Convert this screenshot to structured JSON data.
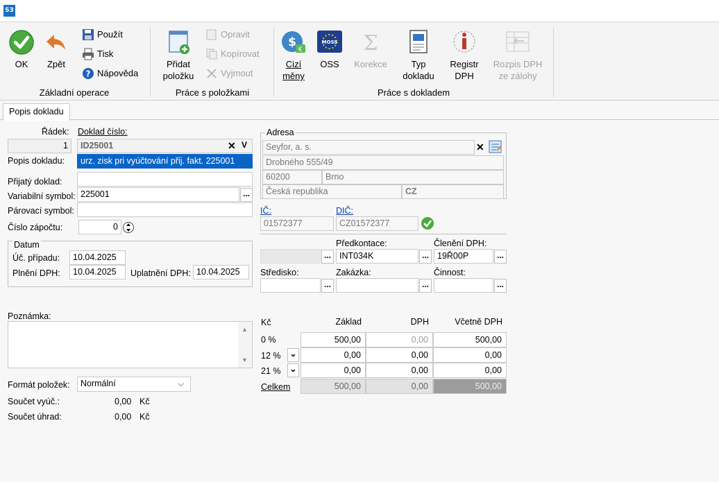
{
  "app": {
    "logo": "S3"
  },
  "ribbon": {
    "ok": "OK",
    "back": "Zpět",
    "use": "Použít",
    "print": "Tisk",
    "help": "Nápověda",
    "group1": "Základní operace",
    "add_item": "Přidat položku",
    "edit": "Opravit",
    "copy": "Kopírovat",
    "remove": "Vyjmout",
    "group2": "Práce s položkami",
    "foreign_currency": "Cizí měny",
    "oss": "OSS",
    "correction": "Korekce",
    "doc_type": "Typ dokladu",
    "vat_register": "Registr DPH",
    "vat_breakdown": "Rozpis DPH ze zálohy",
    "group3": "Práce s dokladem"
  },
  "tabs": {
    "popis": "Popis dokladu"
  },
  "form": {
    "radek_label": "Řádek:",
    "radek_value": "1",
    "doklad_label": "Doklad číslo:",
    "doklad_value": "ID25001",
    "popis_label": "Popis dokladu:",
    "popis_value": "urz. zisk pri vyúčtování přij. fakt. 225001",
    "prijaty_label": "Přijatý doklad:",
    "prijaty_value": "",
    "vs_label": "Variabilní symbol:",
    "vs_value": "225001",
    "parovaci_label": "Párovací symbol:",
    "parovaci_value": "",
    "zapoctu_label": "Číslo zápočtu:",
    "zapoctu_value": "0",
    "datum_legend": "Datum",
    "uc_label": "Úč. případu:",
    "uc_value": "10.04.2025",
    "plneni_label": "Plnění DPH:",
    "plneni_value": "10.04.2025",
    "uplatneni_label": "Uplatnění DPH:",
    "uplatneni_value": "10.04.2025",
    "poznamka_label": "Poznámka:",
    "format_label": "Formát položek:",
    "format_value": "Normální",
    "soucet_vyuc_label": "Součet vyúč.:",
    "soucet_vyuc_value": "0,00",
    "soucet_vyuc_cur": "Kč",
    "soucet_uhrad_label": "Součet úhrad:",
    "soucet_uhrad_value": "0,00",
    "soucet_uhrad_cur": "Kč"
  },
  "address": {
    "legend": "Adresa",
    "name": "Seyfor, a. s.",
    "street": "Drobného 555/49",
    "zip": "60200",
    "city": "Brno",
    "country": "Česká republika",
    "country_code": "CZ"
  },
  "ids": {
    "ic_label": "IČ:",
    "ic_value": "01572377",
    "dic_label": "DIČ:",
    "dic_value": "CZ01572377"
  },
  "accounting": {
    "predkontace_label": "Předkontace:",
    "predkontace_value": "INT034K",
    "cleneni_label": "Členění DPH:",
    "cleneni_value": "19Ř00P",
    "stredisko_label": "Středisko:",
    "zakazka_label": "Zakázka:",
    "cinnost_label": "Činnost:"
  },
  "vat_table": {
    "headers": [
      "Kč",
      "Základ",
      "DPH",
      "Včetně DPH"
    ],
    "rows": [
      {
        "rate": "0 %",
        "base": "500,00",
        "vat": "0,00",
        "total": "500,00"
      },
      {
        "rate": "12 %",
        "base": "0,00",
        "vat": "0,00",
        "total": "0,00"
      },
      {
        "rate": "21 %",
        "base": "0,00",
        "vat": "0,00",
        "total": "0,00"
      }
    ],
    "total": {
      "label": "Celkem",
      "base": "500,00",
      "vat": "0,00",
      "total": "500,00"
    }
  },
  "colors": {
    "accent": "#1b6fc2",
    "ok_green": "#44a544",
    "back_orange": "#e07a2f",
    "selection": "#0a64c8"
  }
}
